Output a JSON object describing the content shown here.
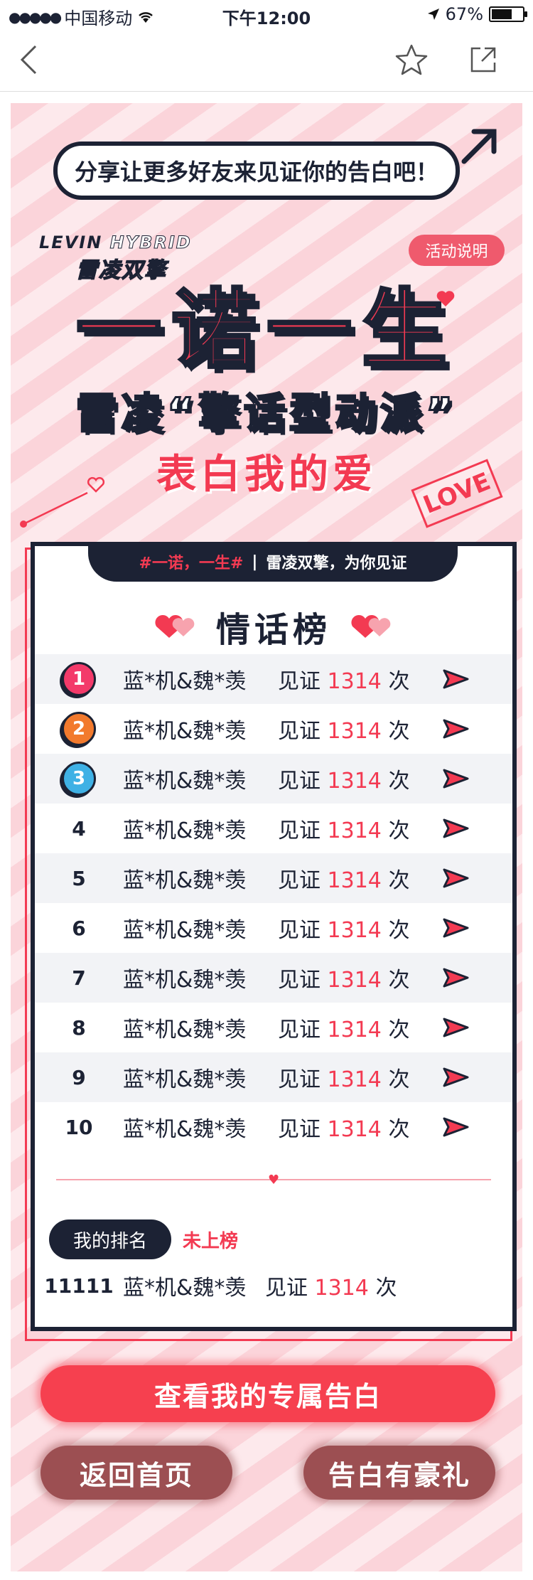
{
  "status_bar": {
    "carrier": "中国移动",
    "time": "下午12:00",
    "battery": "67%",
    "battery_level": 0.67
  },
  "banner": {
    "share_text": "分享让更多好友来见证你的告白吧！",
    "brand_en_1": "LEVIN",
    "brand_en_2": "HYBRID",
    "brand_cn": "雷凌双擎",
    "rules_button": "活动说明",
    "headline_1": "一诺一生",
    "headline_2": "雷凌“擎话型动派”",
    "headline_3": "表白我的爱",
    "stamp": "LOVE"
  },
  "board": {
    "tag_hashtag": "#一诺，一生#",
    "tag_separator": "|",
    "tag_text": "雷凌双擎，为你见证",
    "title": "情话榜",
    "rows": [
      {
        "rank": "1",
        "name": "蓝*机&魏*羡",
        "prefix": "见证",
        "count": "1314",
        "suffix": "次"
      },
      {
        "rank": "2",
        "name": "蓝*机&魏*羡",
        "prefix": "见证",
        "count": "1314",
        "suffix": "次"
      },
      {
        "rank": "3",
        "name": "蓝*机&魏*羡",
        "prefix": "见证",
        "count": "1314",
        "suffix": "次"
      },
      {
        "rank": "4",
        "name": "蓝*机&魏*羡",
        "prefix": "见证",
        "count": "1314",
        "suffix": "次"
      },
      {
        "rank": "5",
        "name": "蓝*机&魏*羡",
        "prefix": "见证",
        "count": "1314",
        "suffix": "次"
      },
      {
        "rank": "6",
        "name": "蓝*机&魏*羡",
        "prefix": "见证",
        "count": "1314",
        "suffix": "次"
      },
      {
        "rank": "7",
        "name": "蓝*机&魏*羡",
        "prefix": "见证",
        "count": "1314",
        "suffix": "次"
      },
      {
        "rank": "8",
        "name": "蓝*机&魏*羡",
        "prefix": "见证",
        "count": "1314",
        "suffix": "次"
      },
      {
        "rank": "9",
        "name": "蓝*机&魏*羡",
        "prefix": "见证",
        "count": "1314",
        "suffix": "次"
      },
      {
        "rank": "10",
        "name": "蓝*机&魏*羡",
        "prefix": "见证",
        "count": "1314",
        "suffix": "次"
      }
    ],
    "medal_colors": [
      "#f33a6a",
      "#f27a2d",
      "#3fb1e5"
    ],
    "my_rank_label": "我的排名",
    "my_rank_status": "未上榜",
    "my_row": {
      "rank": "11111",
      "name": "蓝*机&魏*羡",
      "prefix": "见证",
      "count": "1314",
      "suffix": "次"
    }
  },
  "buttons": {
    "primary": "查看我的专属告白",
    "back_home": "返回首页",
    "gift": "告白有豪礼"
  },
  "colors": {
    "accent": "#f33a52",
    "navy": "#1c2234",
    "stripe_light": "#fde9ec",
    "stripe_dark": "#fbd4da"
  }
}
